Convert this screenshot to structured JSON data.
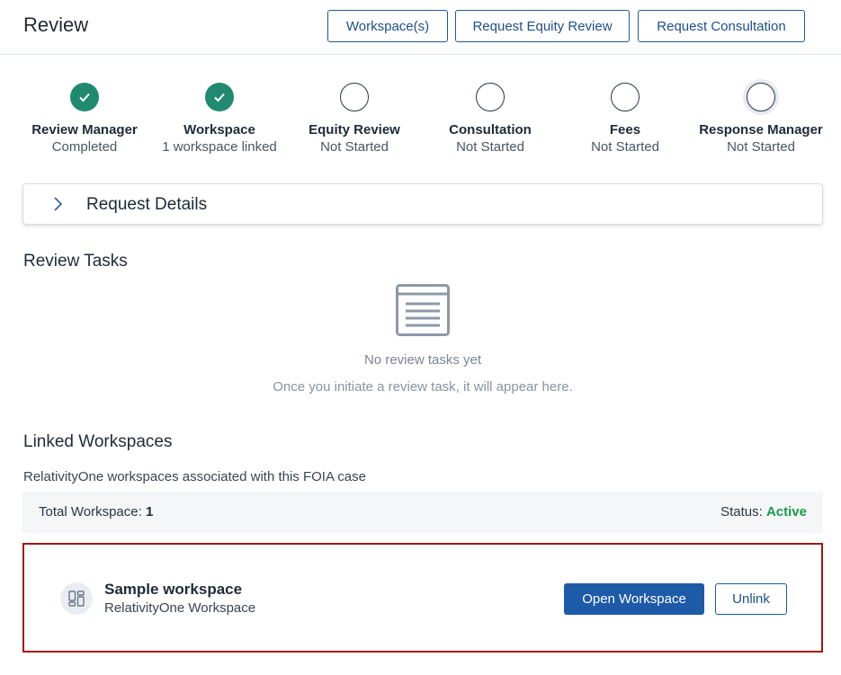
{
  "header": {
    "title": "Review",
    "buttons": {
      "workspaces": "Workspace(s)",
      "equity": "Request Equity Review",
      "consultation": "Request Consultation"
    }
  },
  "steps": [
    {
      "name": "Review Manager",
      "status": "Completed",
      "state": "done"
    },
    {
      "name": "Workspace",
      "status": "1 workspace linked",
      "state": "done"
    },
    {
      "name": "Equity Review",
      "status": "Not Started",
      "state": "todo"
    },
    {
      "name": "Consultation",
      "status": "Not Started",
      "state": "todo"
    },
    {
      "name": "Fees",
      "status": "Not Started",
      "state": "todo"
    },
    {
      "name": "Response Manager",
      "status": "Not Started",
      "state": "current"
    }
  ],
  "request_details": {
    "label": "Request Details",
    "icon": "chevron-right-icon"
  },
  "review_tasks": {
    "title": "Review Tasks",
    "empty_icon": "document-list-icon",
    "empty_title": "No review tasks yet",
    "empty_subtitle": "Once you initiate a review task, it will appear here."
  },
  "linked_workspaces": {
    "title": "Linked Workspaces",
    "description": "RelativityOne workspaces associated with this FOIA case",
    "total_label": "Total Workspace:",
    "total_value": "1",
    "status_label": "Status:",
    "status_value": "Active",
    "items": [
      {
        "name": "Sample workspace",
        "type": "RelativityOne Workspace",
        "icon": "workspace-grid-icon",
        "open_label": "Open Workspace",
        "unlink_label": "Unlink"
      }
    ]
  },
  "colors": {
    "primary": "#1d5aa8",
    "success": "#1f8a70",
    "active_status": "#1a9a4a",
    "highlight_border": "#a31515"
  }
}
